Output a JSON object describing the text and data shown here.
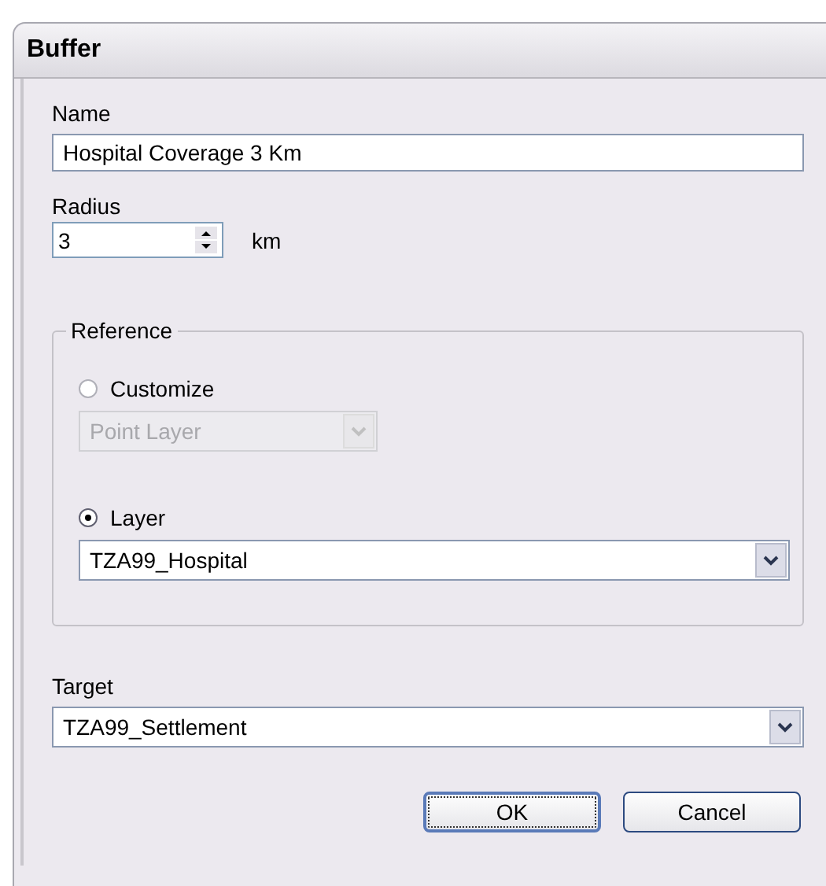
{
  "window": {
    "title": "Buffer"
  },
  "name": {
    "label": "Name",
    "value": "Hospital Coverage 3 Km"
  },
  "radius": {
    "label": "Radius",
    "value": "3",
    "unit": "km"
  },
  "reference": {
    "title": "Reference",
    "options": [
      {
        "label": "Customize",
        "selected": false,
        "dropdown": {
          "value": "Point Layer",
          "disabled": true
        }
      },
      {
        "label": "Layer",
        "selected": true,
        "dropdown": {
          "value": "TZA99_Hospital",
          "disabled": false
        }
      }
    ]
  },
  "target": {
    "label": "Target",
    "value": "TZA99_Settlement"
  },
  "buttons": [
    {
      "label": "OK",
      "default": true
    },
    {
      "label": "Cancel",
      "default": false
    }
  ]
}
